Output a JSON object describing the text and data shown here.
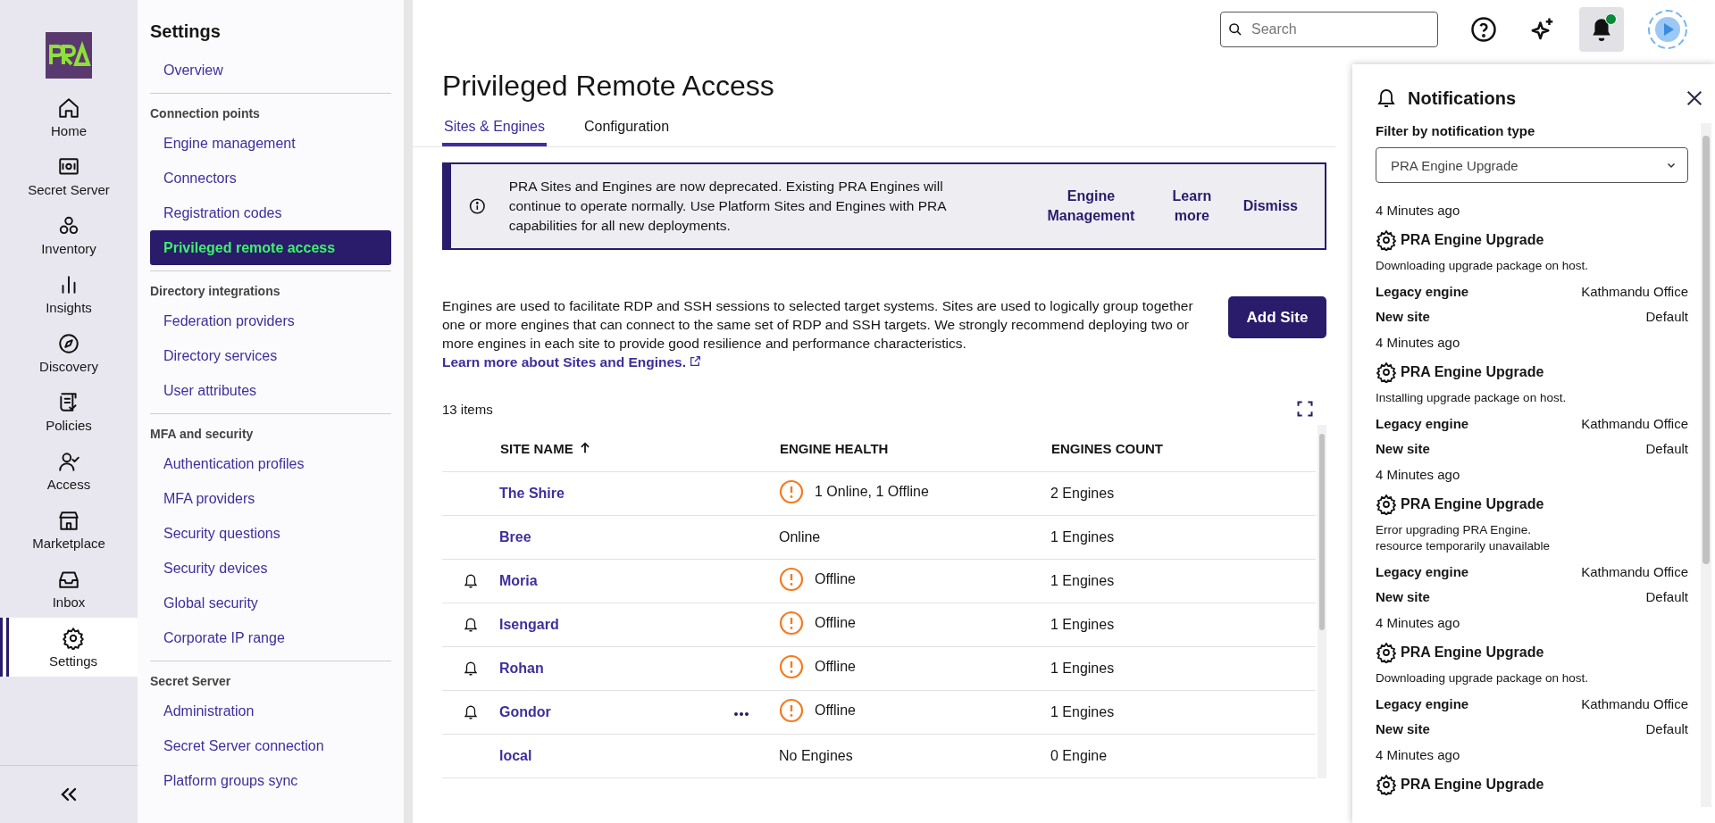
{
  "rail": {
    "items": [
      {
        "label": "Home",
        "selected": false
      },
      {
        "label": "Secret Server",
        "selected": false
      },
      {
        "label": "Inventory",
        "selected": false
      },
      {
        "label": "Insights",
        "selected": false
      },
      {
        "label": "Discovery",
        "selected": false
      },
      {
        "label": "Policies",
        "selected": false
      },
      {
        "label": "Access",
        "selected": false
      },
      {
        "label": "Marketplace",
        "selected": false
      },
      {
        "label": "Inbox",
        "selected": false
      },
      {
        "label": "Settings",
        "selected": true
      }
    ]
  },
  "sidebar": {
    "title": "Settings",
    "groups": [
      {
        "items": [
          {
            "label": "Overview",
            "selected": false
          }
        ]
      },
      {
        "heading": "Connection points",
        "items": [
          {
            "label": "Engine management",
            "selected": false
          },
          {
            "label": "Connectors",
            "selected": false
          },
          {
            "label": "Registration codes",
            "selected": false
          },
          {
            "label": "Privileged remote access",
            "selected": true
          }
        ]
      },
      {
        "heading": "Directory integrations",
        "items": [
          {
            "label": "Federation providers",
            "selected": false
          },
          {
            "label": "Directory services",
            "selected": false
          },
          {
            "label": "User attributes",
            "selected": false
          }
        ]
      },
      {
        "heading": "MFA and security",
        "items": [
          {
            "label": "Authentication profiles",
            "selected": false
          },
          {
            "label": "MFA providers",
            "selected": false
          },
          {
            "label": "Security questions",
            "selected": false
          },
          {
            "label": "Security devices",
            "selected": false
          },
          {
            "label": "Global security",
            "selected": false
          },
          {
            "label": "Corporate IP range",
            "selected": false
          }
        ]
      },
      {
        "heading": "Secret Server",
        "items": [
          {
            "label": "Administration",
            "selected": false
          },
          {
            "label": "Secret Server connection",
            "selected": false
          },
          {
            "label": "Platform groups sync",
            "selected": false
          }
        ]
      }
    ]
  },
  "header": {
    "search": {
      "placeholder": "Search"
    },
    "unread": true
  },
  "page": {
    "title": "Privileged Remote Access",
    "tabs": [
      {
        "label": "Sites & Engines",
        "selected": true
      },
      {
        "label": "Configuration",
        "selected": false
      }
    ],
    "banner": {
      "text": "PRA Sites and Engines are now deprecated. Existing PRA Engines will continue to operate normally. Use Platform Sites and Engines with PRA capabilities for all new deployments.",
      "actions": [
        "Engine Management",
        "Learn more",
        "Dismiss"
      ]
    },
    "description": "Engines are used to facilitate RDP and SSH sessions to selected target systems. Sites are used to logically group together one or more engines that can connect to the same set of RDP and SSH targets. We strongly recommend deploying two or more engines in each site to provide good resilience and performance characteristics.",
    "learn_link": "Learn more about Sites and Engines.",
    "add_button": "Add Site",
    "item_count": "13 items",
    "table": {
      "columns": [
        "SITE NAME",
        "ENGINE HEALTH",
        "ENGINES COUNT"
      ],
      "rows": [
        {
          "alert": false,
          "name": "The Shire",
          "actions": false,
          "warning": true,
          "health": "1 Online, 1 Offline",
          "count": "2 Engines"
        },
        {
          "alert": false,
          "name": "Bree",
          "actions": false,
          "warning": false,
          "health": "Online",
          "count": "1 Engines"
        },
        {
          "alert": true,
          "name": "Moria",
          "actions": false,
          "warning": true,
          "health": "Offline",
          "count": "1 Engines"
        },
        {
          "alert": true,
          "name": "Isengard",
          "actions": false,
          "warning": true,
          "health": "Offline",
          "count": "1 Engines"
        },
        {
          "alert": true,
          "name": "Rohan",
          "actions": false,
          "warning": true,
          "health": "Offline",
          "count": "1 Engines"
        },
        {
          "alert": true,
          "name": "Gondor",
          "actions": true,
          "warning": true,
          "health": "Offline",
          "count": "1 Engines"
        },
        {
          "alert": false,
          "name": "local",
          "actions": false,
          "warning": false,
          "health": "No Engines",
          "count": "0 Engine"
        }
      ]
    }
  },
  "notifications": {
    "title": "Notifications",
    "filter_label": "Filter by notification type",
    "filter_value": "PRA Engine Upgrade",
    "items": [
      {
        "time": "4 Minutes ago",
        "title": "PRA Engine Upgrade",
        "message": "Downloading upgrade package on host.",
        "details": [
          {
            "label": "Legacy engine",
            "value": "Kathmandu Office"
          },
          {
            "label": "New site",
            "value": "Default"
          }
        ]
      },
      {
        "time": "4 Minutes ago",
        "title": "PRA Engine Upgrade",
        "message": "Installing upgrade package on host.",
        "details": [
          {
            "label": "Legacy engine",
            "value": "Kathmandu Office"
          },
          {
            "label": "New site",
            "value": "Default"
          }
        ]
      },
      {
        "time": "4 Minutes ago",
        "title": "PRA Engine Upgrade",
        "message": "Error upgrading PRA Engine.\n resource temporarily unavailable",
        "details": [
          {
            "label": "Legacy engine",
            "value": "Kathmandu Office"
          },
          {
            "label": "New site",
            "value": "Default"
          }
        ]
      },
      {
        "time": "4 Minutes ago",
        "title": "PRA Engine Upgrade",
        "message": "Downloading upgrade package on host.",
        "details": [
          {
            "label": "Legacy engine",
            "value": "Kathmandu Office"
          },
          {
            "label": "New site",
            "value": "Default"
          }
        ]
      },
      {
        "time": "4 Minutes ago",
        "title": "PRA Engine Upgrade"
      }
    ]
  }
}
